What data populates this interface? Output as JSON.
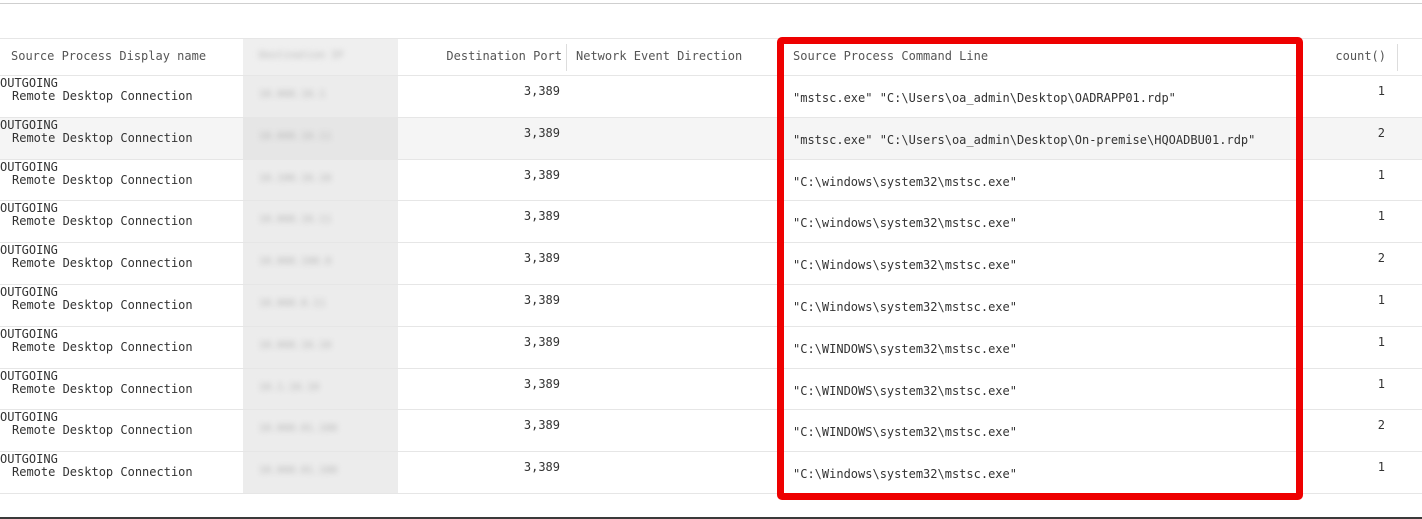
{
  "table": {
    "columns": [
      {
        "key": "name",
        "label": "Source Process Display name"
      },
      {
        "key": "ip",
        "label": "Destination IP"
      },
      {
        "key": "port",
        "label": "Destination Port"
      },
      {
        "key": "direction",
        "label": "Network Event Direction"
      },
      {
        "key": "cmd",
        "label": "Source Process Command Line"
      },
      {
        "key": "count",
        "label": "count()"
      }
    ],
    "rows": [
      {
        "name": "Remote Desktop Connection",
        "ip": "10.000.10.1",
        "port": "3,389",
        "direction": "OUTGOING",
        "cmd": "\"mstsc.exe\" \"C:\\Users\\oa_admin\\Desktop\\OADRAPP01.rdp\"",
        "count": "1"
      },
      {
        "name": "Remote Desktop Connection",
        "ip": "10.000.10.11",
        "port": "3,389",
        "direction": "OUTGOING",
        "cmd": "\"mstsc.exe\" \"C:\\Users\\oa_admin\\Desktop\\On-premise\\HQOADBU01.rdp\"",
        "count": "2"
      },
      {
        "name": "Remote Desktop Connection",
        "ip": "10.100.10.10",
        "port": "3,389",
        "direction": "OUTGOING",
        "cmd": "\"C:\\windows\\system32\\mstsc.exe\"",
        "count": "1"
      },
      {
        "name": "Remote Desktop Connection",
        "ip": "10.000.10.11",
        "port": "3,389",
        "direction": "OUTGOING",
        "cmd": "\"C:\\windows\\system32\\mstsc.exe\"",
        "count": "1"
      },
      {
        "name": "Remote Desktop Connection",
        "ip": "10.000.100.0",
        "port": "3,389",
        "direction": "OUTGOING",
        "cmd": "\"C:\\Windows\\system32\\mstsc.exe\"",
        "count": "2"
      },
      {
        "name": "Remote Desktop Connection",
        "ip": "10.000.0.11",
        "port": "3,389",
        "direction": "OUTGOING",
        "cmd": "\"C:\\Windows\\system32\\mstsc.exe\"",
        "count": "1"
      },
      {
        "name": "Remote Desktop Connection",
        "ip": "10.000.10.10",
        "port": "3,389",
        "direction": "OUTGOING",
        "cmd": "\"C:\\WINDOWS\\system32\\mstsc.exe\"",
        "count": "1"
      },
      {
        "name": "Remote Desktop Connection",
        "ip": "10.1.10.10",
        "port": "3,389",
        "direction": "OUTGOING",
        "cmd": "\"C:\\WINDOWS\\system32\\mstsc.exe\"",
        "count": "1"
      },
      {
        "name": "Remote Desktop Connection",
        "ip": "10.000.01.100",
        "port": "3,389",
        "direction": "OUTGOING",
        "cmd": "\"C:\\WINDOWS\\system32\\mstsc.exe\"",
        "count": "2"
      },
      {
        "name": "Remote Desktop Connection",
        "ip": "10.000.01.100",
        "port": "3,389",
        "direction": "OUTGOING",
        "cmd": "\"C:\\Windows\\system32\\mstsc.exe\"",
        "count": "1"
      }
    ]
  },
  "highlight": {
    "color": "#ee0000"
  }
}
